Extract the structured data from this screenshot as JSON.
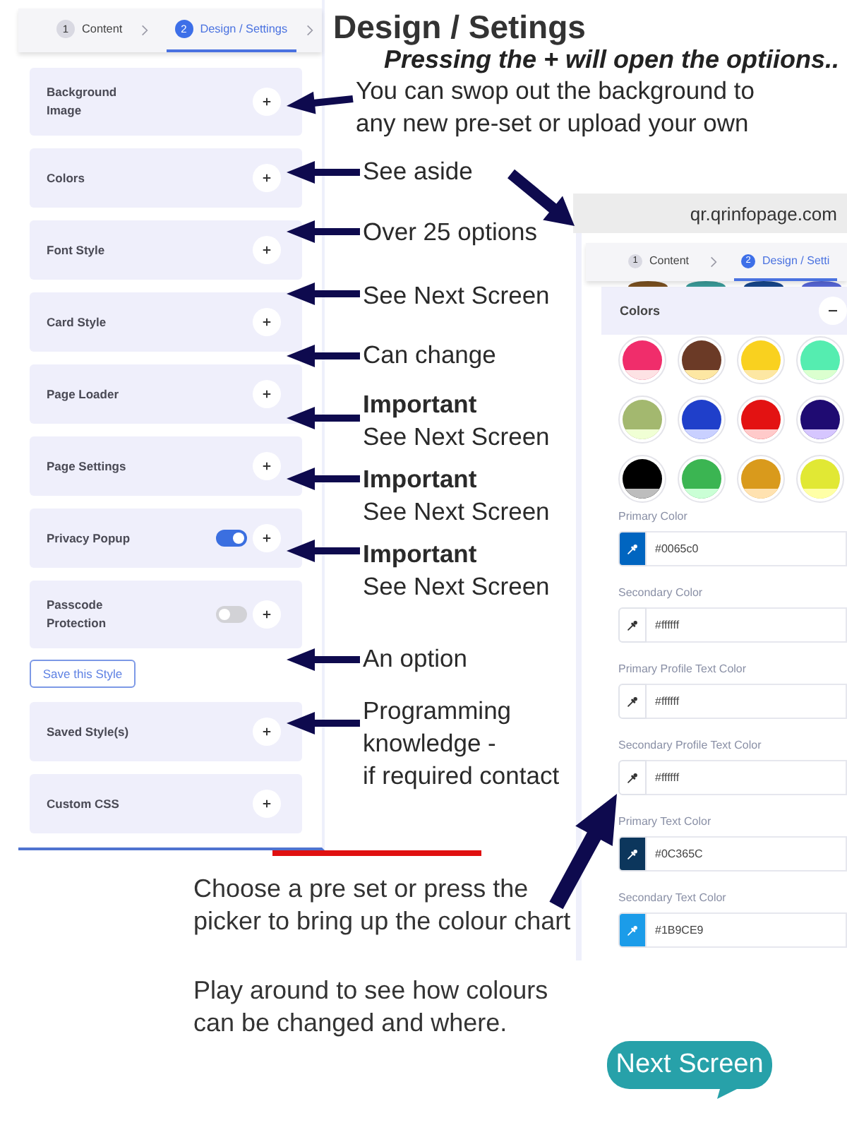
{
  "title": "Design / Setings",
  "subtitle": "Pressing the + will open the optiions..",
  "settings_panel": {
    "steps": [
      {
        "number": "1",
        "label": "Content",
        "selected": false
      },
      {
        "number": "2",
        "label": "Design / Settings",
        "selected": true
      }
    ],
    "sections": [
      {
        "kind": "section",
        "label": "Background Image"
      },
      {
        "kind": "section",
        "label": "Colors"
      },
      {
        "kind": "section",
        "label": "Font Style"
      },
      {
        "kind": "section",
        "label": "Card Style"
      },
      {
        "kind": "section",
        "label": "Page Loader"
      },
      {
        "kind": "section",
        "label": "Page Settings"
      },
      {
        "kind": "toggle",
        "label": "Privacy Popup",
        "on": true
      },
      {
        "kind": "toggle",
        "label": "Passcode Protection",
        "on": false
      },
      {
        "kind": "button",
        "label": "Save this Style"
      },
      {
        "kind": "section",
        "label": "Saved Style(s)"
      },
      {
        "kind": "section",
        "label": "Custom CSS"
      }
    ]
  },
  "callouts": [
    {
      "text": "You can swop out the background to\nany new pre-set or upload your own"
    },
    {
      "text": "See aside"
    },
    {
      "text": "Over 25 options"
    },
    {
      "text": "See Next Screen"
    },
    {
      "text": "Can change"
    },
    {
      "heading": "Important",
      "text": "See Next Screen"
    },
    {
      "heading": "Important",
      "text": "See Next Screen"
    },
    {
      "heading": "Important",
      "text": "See Next Screen"
    },
    {
      "text": "An option"
    },
    {
      "text": "Programming\nknowledge -\nif required contact"
    }
  ],
  "preview": {
    "url": "qr.qrinfopage.com",
    "steps": [
      {
        "number": "1",
        "label": "Content",
        "selected": false
      },
      {
        "number": "2",
        "label": "Design / Setti",
        "selected": true
      }
    ],
    "hidden_presets": [
      {
        "color": "#7a5020"
      },
      {
        "color": "#3a9a98"
      },
      {
        "color": "#17468a"
      },
      {
        "color": "#5565d5"
      }
    ],
    "section": {
      "title": "Colors"
    },
    "presets": [
      {
        "color": "#f02d6b",
        "band": {
          "color": "#fde2e4"
        }
      },
      {
        "color": "#6b3a26",
        "band": {
          "color": "#fde7a3"
        }
      },
      {
        "color": "#f9d11f",
        "band": {
          "color": "#fde7a3"
        }
      },
      {
        "color": "#55edb0",
        "band": {
          "color": "#dbffcf"
        }
      },
      {
        "color": "#a3b86f",
        "band": {
          "color": "#f0ffd4"
        }
      },
      {
        "color": "#1f3fca",
        "band": {
          "color": "#c9d0ff"
        }
      },
      {
        "color": "#e31212",
        "band": {
          "color": "#ffcaca"
        }
      },
      {
        "color": "#1f0b72",
        "band": {
          "color": "#d6c6ff"
        }
      },
      {
        "color": "#000000",
        "band": {
          "color": "#bdbdbd"
        }
      },
      {
        "color": "#3bb552",
        "band": {
          "color": "#caffd5"
        }
      },
      {
        "color": "#d99a1c",
        "band": {
          "color": "#ffe2b0"
        }
      },
      {
        "color": "#e1e834",
        "band": {
          "color": "#ffffa6"
        }
      }
    ],
    "fields": [
      {
        "label": "Primary Color",
        "value": "#0065c0",
        "color": "#0065c0"
      },
      {
        "label": "Secondary Color",
        "value": "#ffffff",
        "color": "#ffffff"
      },
      {
        "label": "Primary Profile Text Color",
        "value": "#ffffff",
        "color": "#ffffff"
      },
      {
        "label": "Secondary Profile Text Color",
        "value": "#ffffff",
        "color": "#ffffff"
      },
      {
        "label": "Primary Text Color",
        "value": "#0C365C",
        "color": "#0c365c"
      },
      {
        "label": "Secondary Text Color",
        "value": "#1B9CE9",
        "color": "#1b9ce9"
      }
    ]
  },
  "notes": [
    "Choose a pre set or press the\npicker to bring up the colour chart",
    "Play around to see how colours\ncan be changed and where."
  ],
  "next_button": "Next Screen"
}
